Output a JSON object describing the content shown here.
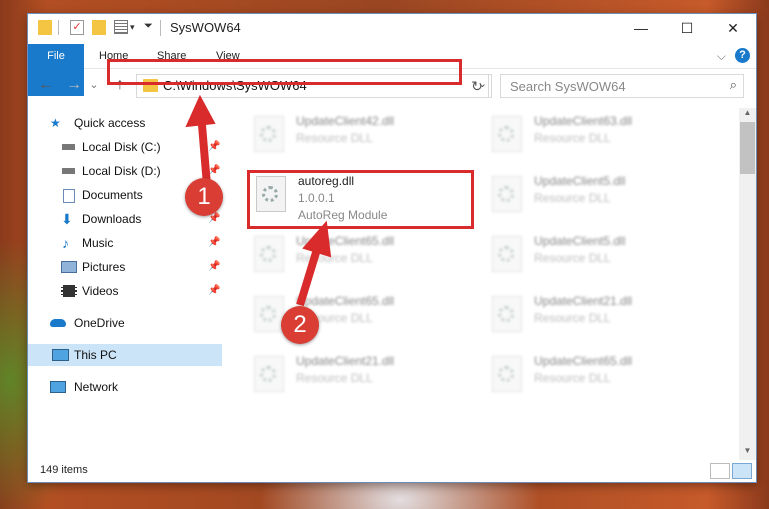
{
  "window": {
    "title": "SysWOW64",
    "min_glyph": "—",
    "max_glyph": "☐",
    "close_glyph": "✕"
  },
  "quick_access_toolbar": {
    "check_glyph": "✓",
    "drop_glyph": "▾",
    "down_glyph": "⏷"
  },
  "ribbon": {
    "tabs": [
      "File",
      "Home",
      "Share",
      "View"
    ],
    "expand_glyph": "⌵",
    "help_glyph": "?"
  },
  "nav": {
    "back_glyph": "←",
    "forward_glyph": "→",
    "recent_glyph": "⌄",
    "up_glyph": "↑",
    "address": "C:\\Windows\\SysWOW64",
    "address_drop": "⌄",
    "refresh_glyph": "↻",
    "search_placeholder": "Search SysWOW64",
    "search_glyph": "⌕"
  },
  "sidebar": {
    "pin_glyph": "📌",
    "items": [
      {
        "label": "Quick access",
        "icon": "star-icon"
      },
      {
        "label": "Local Disk (C:)",
        "icon": "drive-icon"
      },
      {
        "label": "Local Disk (D:)",
        "icon": "drive-icon"
      },
      {
        "label": "Documents",
        "icon": "documents-icon"
      },
      {
        "label": "Downloads",
        "icon": "download-icon"
      },
      {
        "label": "Music",
        "icon": "music-icon"
      },
      {
        "label": "Pictures",
        "icon": "pictures-icon"
      },
      {
        "label": "Videos",
        "icon": "videos-icon"
      },
      {
        "label": "OneDrive",
        "icon": "cloud-icon"
      },
      {
        "label": "This PC",
        "icon": "computer-icon"
      },
      {
        "label": "Network",
        "icon": "network-icon"
      }
    ]
  },
  "files": [
    {
      "name": "UpdateClient42.dll",
      "desc": "Resource DLL"
    },
    {
      "name": "UpdateClient63.dll",
      "desc": "Resource DLL"
    },
    {
      "name": "autoreg.dll",
      "version": "1.0.0.1",
      "desc": "AutoReg Module"
    },
    {
      "name": "UpdateClient5.dll",
      "desc": "Resource DLL"
    },
    {
      "name": "UpdateClient65.dll",
      "desc": "Resource DLL"
    },
    {
      "name": "UpdateClient5.dll",
      "desc": "Resource DLL"
    },
    {
      "name": "UpdateClient65.dll",
      "desc": "Resource DLL"
    },
    {
      "name": "UpdateClient21.dll",
      "desc": "Resource DLL"
    },
    {
      "name": "UpdateClient21.dll",
      "desc": "Resource DLL"
    },
    {
      "name": "UpdateClient65.dll",
      "desc": "Resource DLL"
    }
  ],
  "scrollbar": {
    "up_glyph": "▲",
    "down_glyph": "▼"
  },
  "status": {
    "count": "149 items"
  },
  "annotations": {
    "badge1": "1",
    "badge2": "2",
    "color": "#d92b2b"
  }
}
